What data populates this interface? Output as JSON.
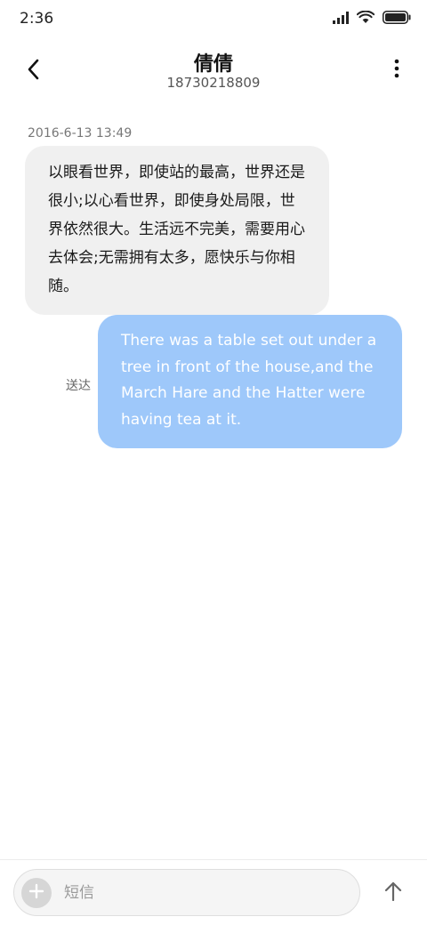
{
  "status_bar": {
    "time": "2:36",
    "icons": [
      "cellular-signal-icon",
      "wifi-icon",
      "battery-icon"
    ]
  },
  "header": {
    "contact_name": "倩倩",
    "contact_number": "18730218809",
    "icons": [
      "back-chevron-icon",
      "more-vertical-icon"
    ]
  },
  "conversation": {
    "timestamp": "2016-6-13 13:49",
    "messages": [
      {
        "direction": "incoming",
        "text": "以眼看世界，即使站的最高，世界还是很小;以心看世界，即使身处局限，世界依然很大。生活远不完美，需要用心去体会;无需拥有太多，愿快乐与你相随。"
      },
      {
        "direction": "outgoing",
        "text": "There was a table set out under a tree in front of the house,and the March Hare and the Hatter were having tea at it.",
        "status": "送达"
      }
    ]
  },
  "composer": {
    "placeholder": "短信",
    "value": "",
    "icons": [
      "plus-icon",
      "send-arrow-up-icon"
    ]
  },
  "colors": {
    "incoming_bubble": "#f0f0f0",
    "outgoing_bubble": "#9ec8fa",
    "outgoing_text": "#ffffff",
    "background": "#ffffff"
  }
}
